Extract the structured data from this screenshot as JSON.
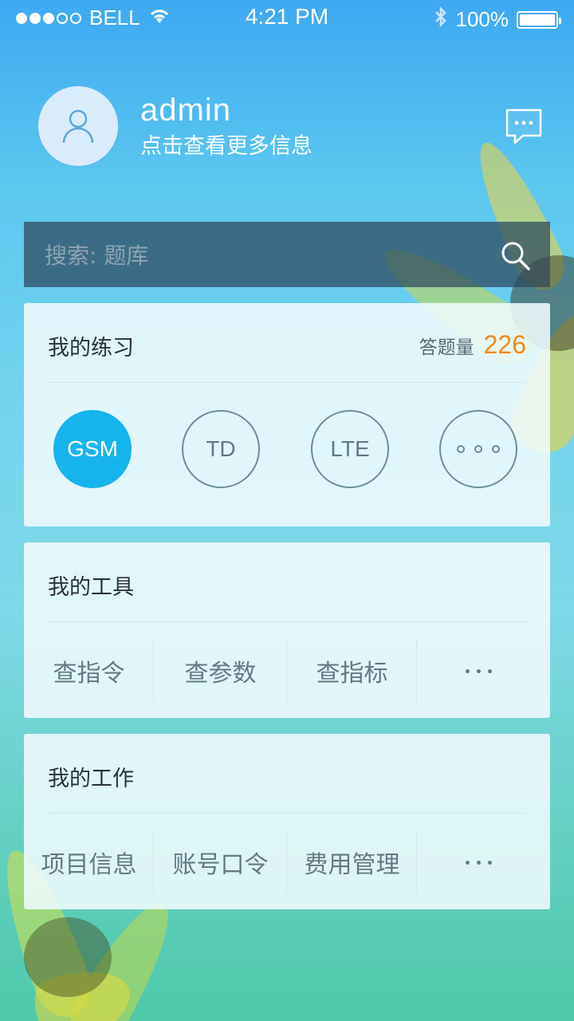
{
  "status_bar": {
    "carrier": "BELL",
    "time": "4:21 PM",
    "battery": "100%"
  },
  "profile": {
    "username": "admin",
    "subtitle": "点击查看更多信息"
  },
  "search": {
    "placeholder": "搜索:  题库"
  },
  "practice": {
    "title": "我的练习",
    "count_label": "答题量",
    "count_value": "226",
    "items": [
      "GSM",
      "TD",
      "LTE"
    ]
  },
  "tools": {
    "title": "我的工具",
    "items": [
      "查指令",
      "查参数",
      "查指标"
    ]
  },
  "work": {
    "title": "我的工作",
    "items": [
      "项目信息",
      "账号口令",
      "费用管理"
    ]
  },
  "icons": [
    "user-avatar-icon",
    "message-icon",
    "search-icon",
    "wifi-icon",
    "bluetooth-icon",
    "battery-icon",
    "more-icon"
  ],
  "colors": {
    "accent": "#15b4ec",
    "count": "#f08a1c"
  }
}
